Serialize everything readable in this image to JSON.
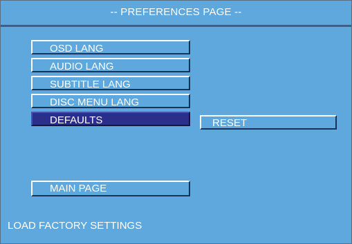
{
  "header": {
    "title": "-- PREFERENCES PAGE --"
  },
  "menu": {
    "items": [
      {
        "label": "OSD LANG"
      },
      {
        "label": "AUDIO LANG"
      },
      {
        "label": "SUBTITLE LANG"
      },
      {
        "label": "DISC MENU LANG"
      },
      {
        "label": "DEFAULTS",
        "selected": true
      }
    ]
  },
  "submenu": {
    "items": [
      {
        "label": "RESET"
      }
    ]
  },
  "main_page_button": {
    "label": "MAIN PAGE"
  },
  "status": {
    "text": "LOAD FACTORY SETTINGS"
  },
  "colors": {
    "background": "#5ea8dd",
    "selected_background": "#2b2f8b",
    "text": "#ffffff",
    "divider": "#2f4f6b"
  }
}
